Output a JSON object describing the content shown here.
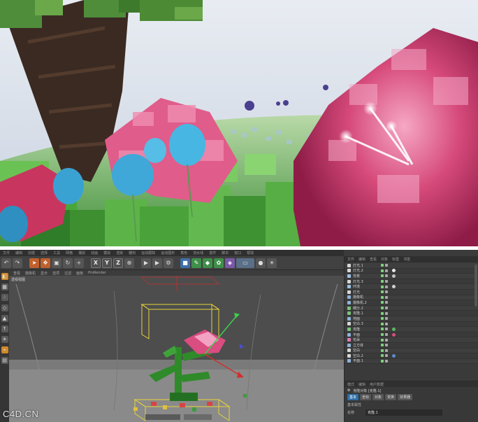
{
  "watermark": "C4D.CN",
  "menubar": {
    "items": [
      "文件",
      "编辑",
      "创建",
      "选择",
      "工具",
      "网格",
      "捕捉",
      "动画",
      "模拟",
      "渲染",
      "雕刻",
      "运动跟踪",
      "运动图形",
      "角色",
      "流水线",
      "插件",
      "脚本",
      "窗口",
      "帮助"
    ]
  },
  "toolbar": {
    "axis_x": "X",
    "axis_y": "Y",
    "axis_z": "Z"
  },
  "viewport": {
    "menu": [
      "查看",
      "摄像机",
      "显示",
      "选项",
      "过滤",
      "面板",
      "ProRender"
    ],
    "label": "透视视图"
  },
  "object_manager": {
    "menu": [
      "文件",
      "编辑",
      "查看",
      "对象",
      "标签",
      "书签"
    ],
    "objects": [
      {
        "name": "灯光.1",
        "color": "#d8d8d8"
      },
      {
        "name": "灯光.2",
        "color": "#d8d8d8"
      },
      {
        "name": "背景",
        "color": "#9cc2e6"
      },
      {
        "name": "灯光.3",
        "color": "#d8d8d8"
      },
      {
        "name": "环境",
        "color": "#9cc2e6"
      },
      {
        "name": "灯光",
        "color": "#d8d8d8"
      },
      {
        "name": "摄像机",
        "color": "#8fb3d9"
      },
      {
        "name": "摄像机.2",
        "color": "#8fb3d9"
      },
      {
        "name": "细分.2",
        "color": "#7ac27a"
      },
      {
        "name": "克隆.1",
        "color": "#7ac27a"
      },
      {
        "name": "地面",
        "color": "#8fb3d9"
      },
      {
        "name": "空白.3",
        "color": "#d8d8d8"
      },
      {
        "name": "克隆",
        "color": "#7ac27a"
      },
      {
        "name": "平面",
        "color": "#8fb3d9"
      },
      {
        "name": "花朵",
        "color": "#e07ab0"
      },
      {
        "name": "立方体",
        "color": "#8fb3d9"
      },
      {
        "name": "空白",
        "color": "#d8d8d8"
      },
      {
        "name": "空白.2",
        "color": "#d8d8d8"
      },
      {
        "name": "平面.1",
        "color": "#8fb3d9"
      }
    ]
  },
  "attribute_manager": {
    "menu": [
      "模式",
      "编辑",
      "用户数据"
    ],
    "title": "克隆对象 [克隆.1]",
    "tabs": [
      "基本",
      "坐标",
      "对象",
      "变换",
      "效果器"
    ],
    "section": "基本属性",
    "field_label": "名称",
    "field_value": "克隆.1"
  },
  "colors": {
    "ui_bg": "#3b3b3b",
    "accent_orange": "#c0602c",
    "selection_yellow": "#e6d23a",
    "active_tab_blue": "#2d6fa8"
  }
}
